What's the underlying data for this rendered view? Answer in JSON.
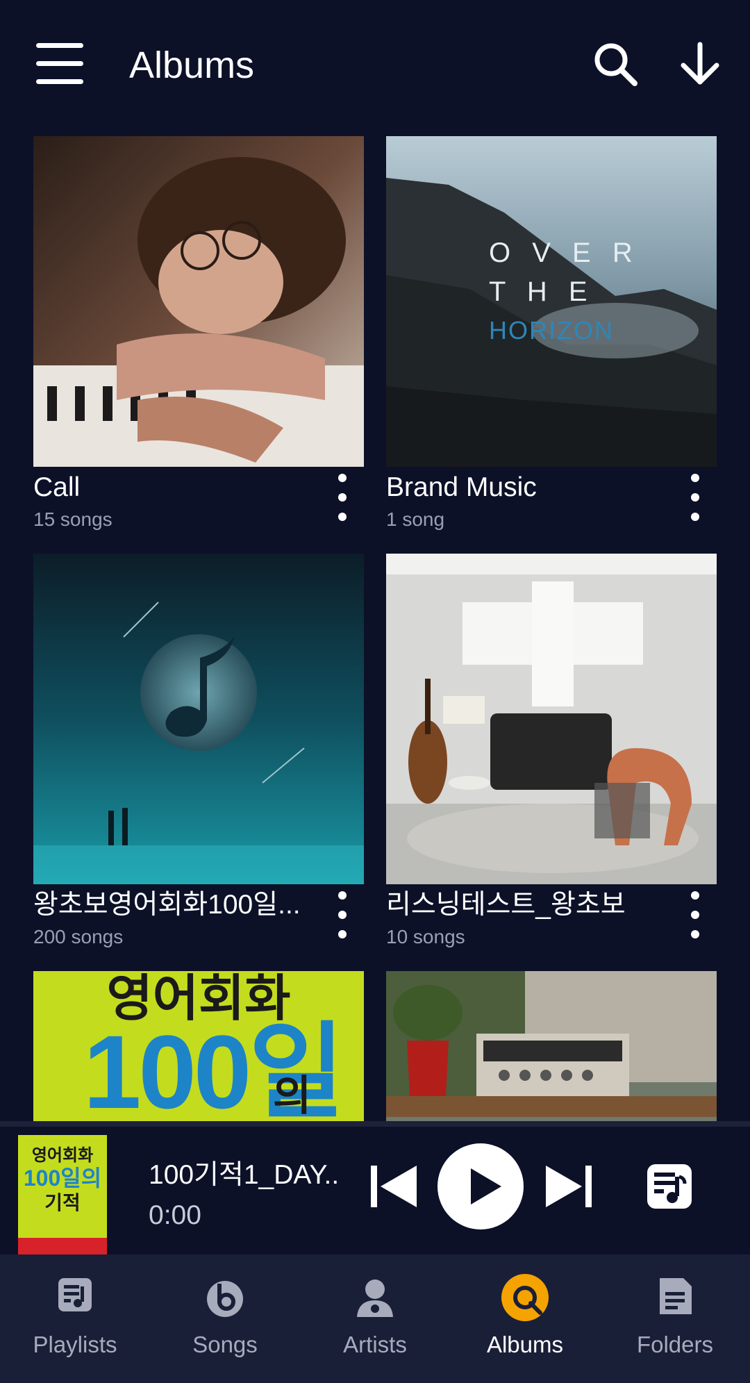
{
  "header": {
    "title": "Albums",
    "menu_icon": "hamburger-menu-icon",
    "search_icon": "search-icon",
    "sort_icon": "arrow-down-icon"
  },
  "albums": [
    {
      "title": "Call",
      "subtitle": "15 songs",
      "cover": "girl-at-piano"
    },
    {
      "title": "Brand Music",
      "subtitle": "1 song",
      "cover": "mountain-landscape",
      "cover_text": [
        "O V E R",
        "T H E",
        "HORIZON"
      ]
    },
    {
      "title": "왕초보영어회화100일...",
      "subtitle": "200 songs",
      "cover": "night-sky-music-note"
    },
    {
      "title": "리스닝테스트_왕초보",
      "subtitle": "10 songs",
      "cover": "music-room-cello"
    },
    {
      "title": "",
      "subtitle": "",
      "cover": "yellow-book-cover",
      "cover_text": [
        "영어회화",
        "100일",
        "의"
      ]
    },
    {
      "title": "",
      "subtitle": "",
      "cover": "vintage-radio"
    }
  ],
  "player": {
    "track_title": "100기적1_DAY..",
    "time": "0:00",
    "art_text": [
      "영어회화",
      "100일의",
      "기적"
    ],
    "controls": [
      "previous-icon",
      "play-icon",
      "next-icon",
      "queue-icon"
    ]
  },
  "bottom_nav": {
    "active": "Albums",
    "items": [
      {
        "label": "Playlists",
        "icon": "playlist-icon"
      },
      {
        "label": "Songs",
        "icon": "songs-icon"
      },
      {
        "label": "Artists",
        "icon": "artist-icon"
      },
      {
        "label": "Albums",
        "icon": "album-icon"
      },
      {
        "label": "Folders",
        "icon": "folder-icon"
      }
    ]
  },
  "colors": {
    "background": "#0c1128",
    "nav_background": "#1a1f38",
    "accent": "#f5a300",
    "secondary_text": "#9aa0b3"
  }
}
